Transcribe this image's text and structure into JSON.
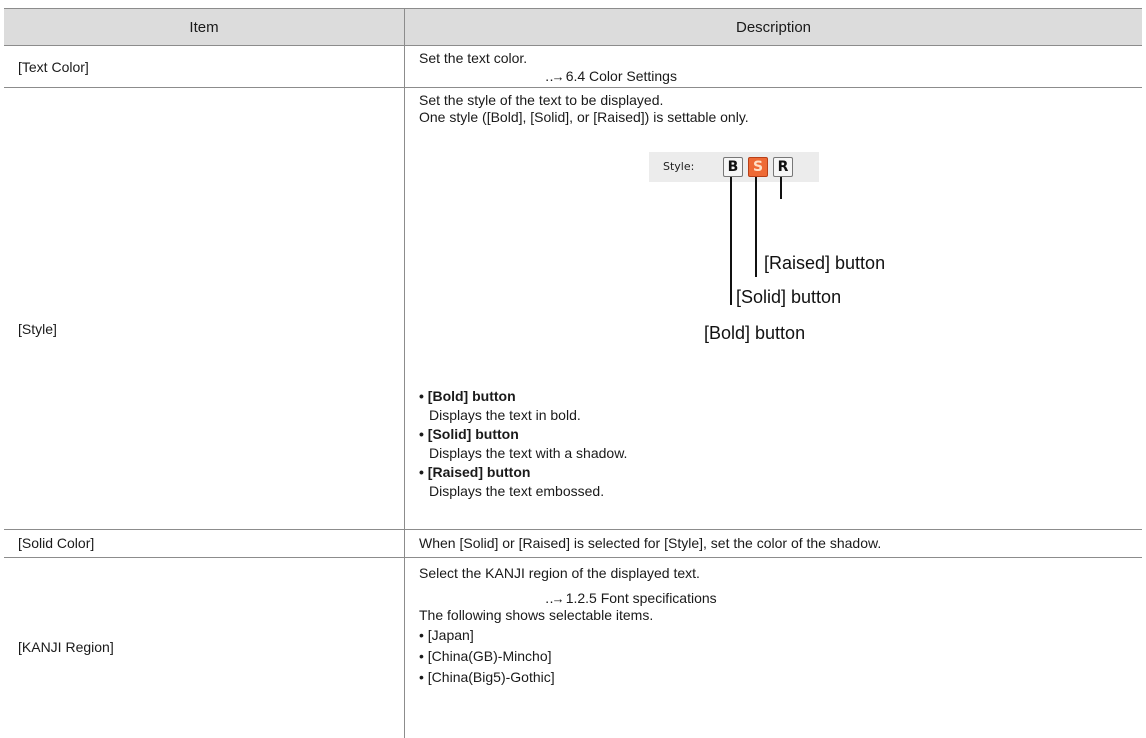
{
  "header": {
    "item": "Item",
    "description": "Description"
  },
  "rows": {
    "text_color": {
      "item": "[Text Color]",
      "desc": "Set the text color.",
      "ref_arrow": "‥→",
      "ref": "6.4 Color Settings"
    },
    "style": {
      "item": "[Style]",
      "desc1": "Set the style of the text to be displayed.",
      "desc2": "One style ([Bold], [Solid], or [Raised]) is settable only.",
      "widget": {
        "label": "Style:",
        "buttons": [
          "B",
          "S",
          "R"
        ],
        "active_index": 1,
        "active_color": "#ee6a35"
      },
      "callouts": {
        "raised": "[Raised] button",
        "solid": "[Solid] button",
        "bold": "[Bold] button"
      },
      "bullets": [
        {
          "title": "• [Bold] button",
          "text": "Displays the text in bold."
        },
        {
          "title": "• [Solid] button",
          "text": "Displays the text with a shadow."
        },
        {
          "title": "• [Raised] button",
          "text": "Displays the text embossed."
        }
      ]
    },
    "solid_color": {
      "item": "[Solid Color]",
      "desc": "When [Solid] or [Raised] is selected for [Style], set the color of the shadow."
    },
    "kanji_region": {
      "item": "[KANJI Region]",
      "desc": "Select the KANJI region of the displayed text.",
      "ref_arrow": "‥→",
      "ref": "1.2.5 Font specifications",
      "desc2": "The following shows selectable items.",
      "options": [
        "• [Japan]",
        "• [China(GB)-Mincho]",
        "• [China(Big5)-Gothic]"
      ]
    }
  }
}
